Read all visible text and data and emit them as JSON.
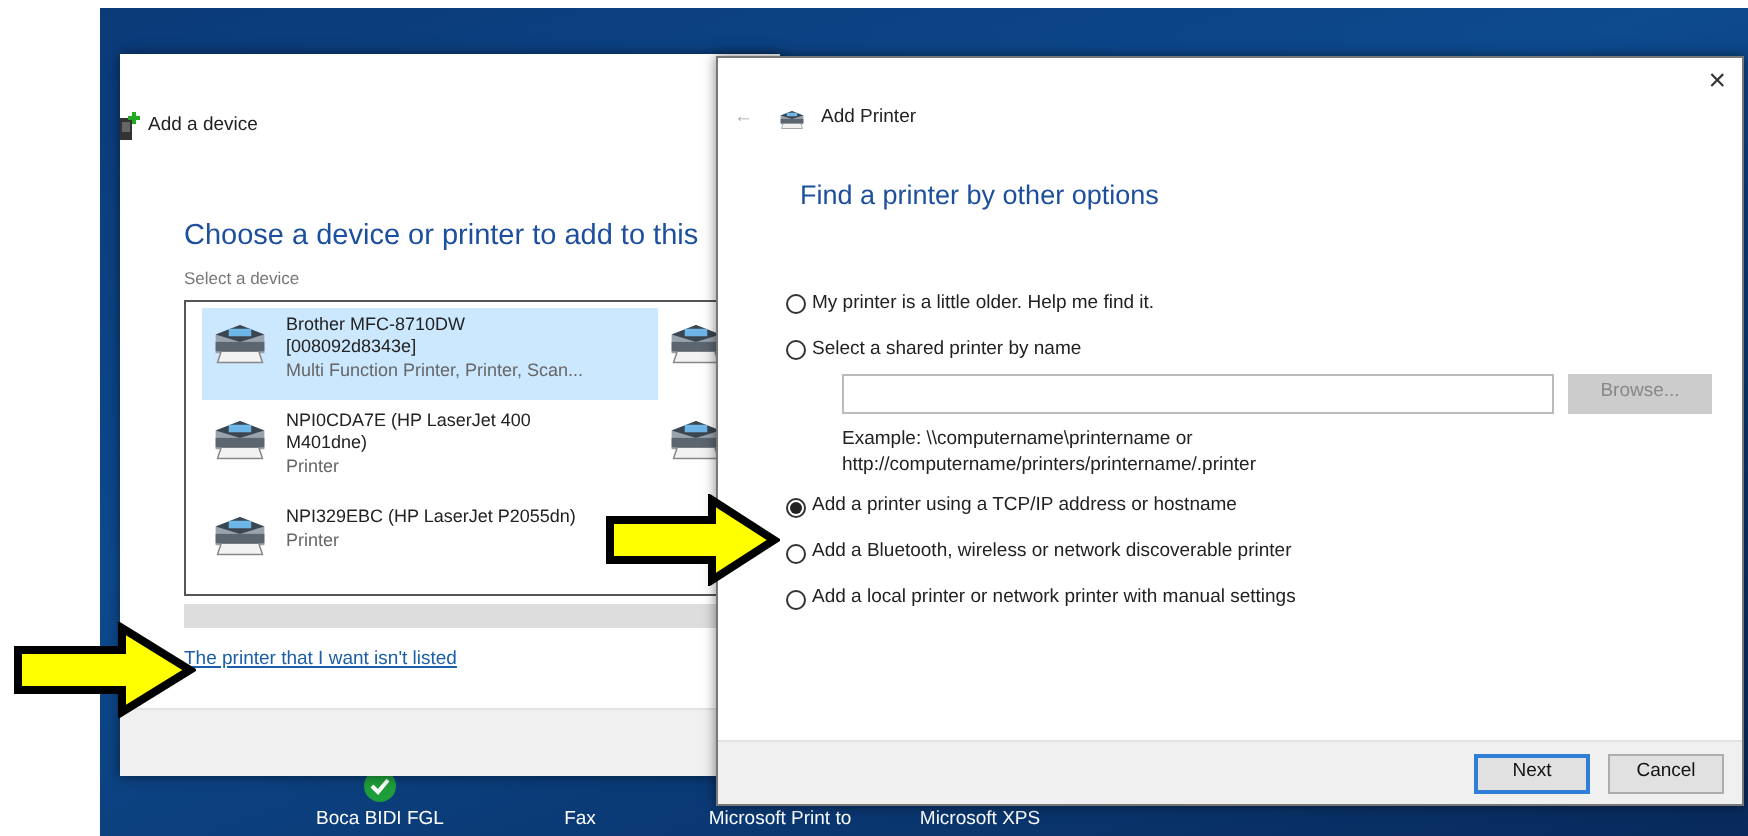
{
  "desktop": {
    "icons": [
      {
        "label": "Boca BIDI FGL",
        "default": true
      },
      {
        "label": "Fax",
        "default": false
      },
      {
        "label": "Microsoft Print to",
        "default": false
      },
      {
        "label": "Microsoft XPS",
        "default": false
      }
    ]
  },
  "device_window": {
    "title": "Add a device",
    "heading": "Choose a device or printer to add to this",
    "subheading": "Select a device",
    "devices": [
      {
        "name_lines": [
          "Brother MFC-8710DW",
          "[008092d8343e]"
        ],
        "type": "Multi Function Printer, Printer, Scan...",
        "selected": true
      },
      {
        "name_lines": [
          "NPI0CDA7E (HP LaserJet 400",
          "M401dne)"
        ],
        "type": "Printer",
        "selected": false
      },
      {
        "name_lines": [
          "NPI329EBC (HP LaserJet P2055dn)"
        ],
        "type": "Printer",
        "selected": false
      }
    ],
    "link": "The printer that I want isn't listed"
  },
  "printer_window": {
    "close_glyph": "×",
    "back_glyph": "←",
    "title": "Add Printer",
    "heading": "Find a printer by other options",
    "options": [
      {
        "kind": "radio",
        "label": "My printer is a little older. Help me find it.",
        "selected": false
      },
      {
        "kind": "radio",
        "label": "Select a shared printer by name",
        "selected": false
      },
      {
        "kind": "path-field",
        "button": "Browse...",
        "disabled": true,
        "example_lines": [
          "Example: \\\\computername\\printername or",
          "http://computername/printers/printername/.printer"
        ]
      },
      {
        "kind": "radio",
        "label": "Add a printer using a TCP/IP address or hostname",
        "selected": true
      },
      {
        "kind": "radio",
        "label": "Add a Bluetooth, wireless or network discoverable printer",
        "selected": false
      },
      {
        "kind": "radio",
        "label": "Add a local printer or network printer with manual settings",
        "selected": false
      }
    ],
    "buttons": [
      {
        "label": "Next",
        "default": true
      },
      {
        "label": "Cancel",
        "default": false
      }
    ]
  }
}
